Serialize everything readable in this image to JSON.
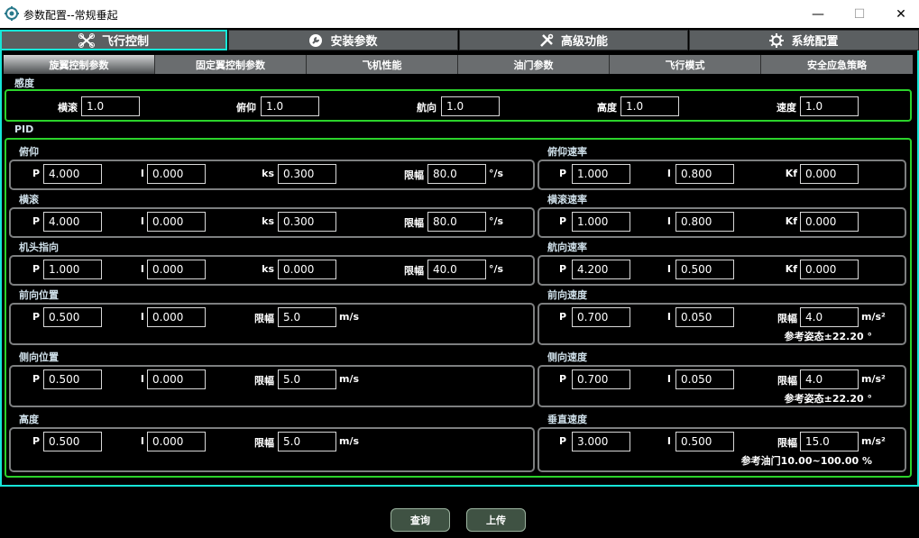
{
  "window": {
    "title": "参数配置--常规垂起",
    "minimize": "—",
    "maximize": "☐",
    "close": "✕"
  },
  "main_tabs": [
    {
      "label": "飞行控制",
      "icon": "drone-icon"
    },
    {
      "label": "安装参数",
      "icon": "wrench-circle-icon"
    },
    {
      "label": "高级功能",
      "icon": "tools-icon"
    },
    {
      "label": "系统配置",
      "icon": "gear-icon"
    }
  ],
  "sub_tabs": [
    "旋翼控制参数",
    "固定翼控制参数",
    "飞机性能",
    "油门参数",
    "飞行模式",
    "安全应急策略"
  ],
  "sensitivity": {
    "title": "感度",
    "fields": [
      {
        "label": "横滚",
        "value": "1.0"
      },
      {
        "label": "俯仰",
        "value": "1.0"
      },
      {
        "label": "航向",
        "value": "1.0"
      },
      {
        "label": "高度",
        "value": "1.0"
      },
      {
        "label": "速度",
        "value": "1.0"
      }
    ]
  },
  "pid": {
    "title": "PID",
    "left": [
      {
        "title": "俯仰",
        "P": "4.000",
        "I": "0.000",
        "ks_label": "ks",
        "ks": "0.300",
        "limit_label": "限幅",
        "limit": "80.0",
        "unit": "°/s"
      },
      {
        "title": "横滚",
        "P": "4.000",
        "I": "0.000",
        "ks_label": "ks",
        "ks": "0.300",
        "limit_label": "限幅",
        "limit": "80.0",
        "unit": "°/s"
      },
      {
        "title": "机头指向",
        "P": "1.000",
        "I": "0.000",
        "ks_label": "ks",
        "ks": "0.000",
        "limit_label": "限幅",
        "limit": "40.0",
        "unit": "°/s"
      },
      {
        "title": "前向位置",
        "P": "0.500",
        "I": "0.000",
        "limit_label": "限幅",
        "limit": "5.0",
        "unit": "m/s"
      },
      {
        "title": "侧向位置",
        "P": "0.500",
        "I": "0.000",
        "limit_label": "限幅",
        "limit": "5.0",
        "unit": "m/s"
      },
      {
        "title": "高度",
        "P": "0.500",
        "I": "0.000",
        "limit_label": "限幅",
        "limit": "5.0",
        "unit": "m/s"
      }
    ],
    "right": [
      {
        "title": "俯仰速率",
        "P": "1.000",
        "I": "0.800",
        "kf_label": "Kf",
        "kf": "0.000"
      },
      {
        "title": "横滚速率",
        "P": "1.000",
        "I": "0.800",
        "kf_label": "Kf",
        "kf": "0.000"
      },
      {
        "title": "航向速率",
        "P": "4.200",
        "I": "0.500",
        "kf_label": "Kf",
        "kf": "0.000"
      },
      {
        "title": "前向速度",
        "P": "0.700",
        "I": "0.050",
        "limit_label": "限幅",
        "limit": "4.0",
        "unit": "m/s²",
        "note": "参考姿态±22.20 °"
      },
      {
        "title": "侧向速度",
        "P": "0.700",
        "I": "0.050",
        "limit_label": "限幅",
        "limit": "4.0",
        "unit": "m/s²",
        "note": "参考姿态±22.20 °"
      },
      {
        "title": "垂直速度",
        "P": "3.000",
        "I": "0.500",
        "limit_label": "限幅",
        "limit": "15.0",
        "unit": "m/s²",
        "note": "参考油门10.00~100.00 %"
      }
    ],
    "p_label": "P",
    "i_label": "I"
  },
  "buttons": {
    "query": "查询",
    "upload": "上传"
  }
}
